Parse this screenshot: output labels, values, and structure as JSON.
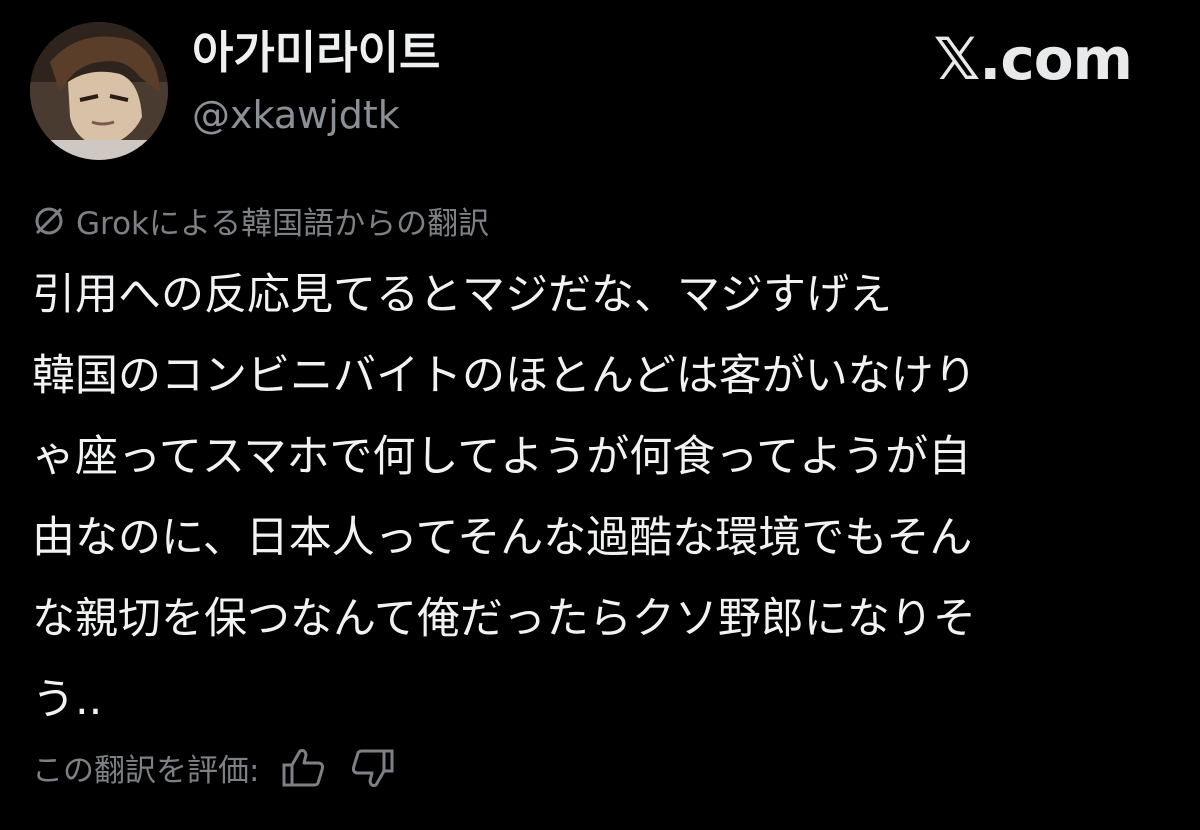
{
  "header": {
    "display_name": "아가미라이트",
    "handle": "@xkawjdtk",
    "brand": "𝕏.com",
    "avatar_icon": "profile-avatar"
  },
  "translation": {
    "icon": "grok-icon",
    "label": "Grokによる韓国語からの翻訳"
  },
  "tweet": {
    "lines": [
      "引用への反応見てるとマジだな、マジすげえ",
      "韓国のコンビニバイトのほとんどは客がいなけり",
      "ゃ座ってスマホで何してようが何食ってようが自",
      "由なのに、日本人ってそんな過酷な環境でもそん",
      "な親切を保つなんて俺だったらクソ野郎になりそ",
      "う.."
    ]
  },
  "rating": {
    "label": "この翻訳を評価:",
    "up_icon": "thumbs-up-icon",
    "down_icon": "thumbs-down-icon"
  },
  "colors": {
    "background": "#000000",
    "text_primary": "#f1f2f3",
    "text_secondary": "#8b9096"
  }
}
